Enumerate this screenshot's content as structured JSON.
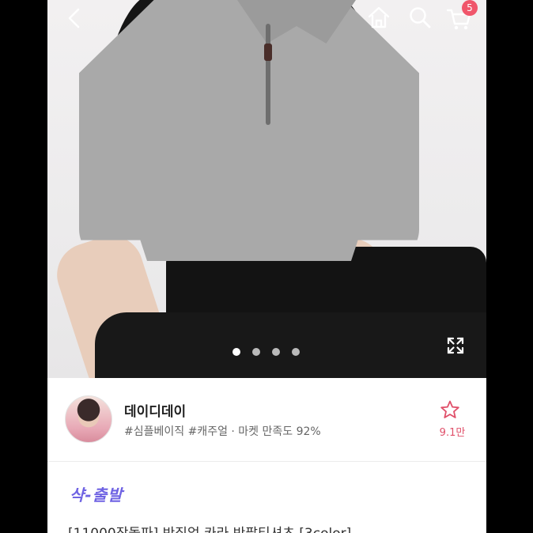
{
  "topbar": {
    "icons": [
      "back-icon",
      "home-icon",
      "search-icon",
      "cart-icon"
    ],
    "cart_count": "5"
  },
  "gallery": {
    "dot_count": 4,
    "active_index": 0
  },
  "seller": {
    "name": "데이디데이",
    "tags": "#심플베이직 #캐주얼 · 마켓 만족도 92%",
    "favorite_count": "9.1만"
  },
  "product": {
    "delivery_badge": "샥-출발",
    "title": "[11000장돌파] 반집업 카라 반팔티셔츠 [3color]"
  },
  "colors": {
    "accent": "#f0566b",
    "delivery": "#6f63e3"
  }
}
